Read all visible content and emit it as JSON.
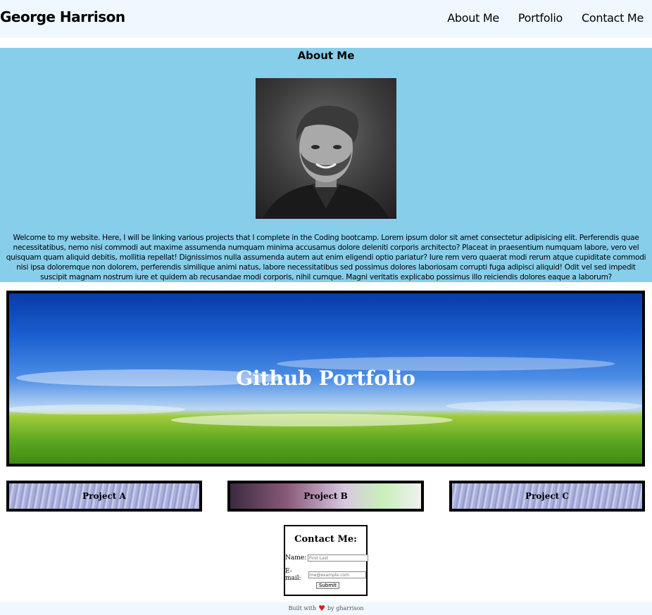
{
  "header": {
    "site_title": "George Harrison",
    "nav": [
      "About Me",
      "Portfolio",
      "Contact Me"
    ]
  },
  "about": {
    "heading": "About Me",
    "portrait_icon": "portrait-photo",
    "text": "Welcome to my website. Here, I will be linking various projects that I complete in the Coding bootcamp. Lorem ipsum dolor sit amet consectetur adipisicing elit. Perferendis quae necessitatibus, nemo nisi commodi aut maxime assumenda numquam minima accusamus dolore deleniti corporis architecto? Placeat in praesentium numquam labore, vero vel quisquam quam aliquid debitis, mollitia repellat! Dignissimos nulla assumenda autem aut enim eligendi optio pariatur? Iure rem vero quaerat modi rerum atque cupiditate commodi nisi ipsa doloremque non dolorem, perferendis similique animi natus, labore necessitatibus sed possimus dolores laboriosam corrupti fuga adipisci aliquid! Odit vel sed impedit suscipit magnam nostrum iure et quidem ab recusandae modi corporis, nihil cumque. Magni veritatis explicabo possimus illo reiciendis dolores eaque a laborum?"
  },
  "portfolio": {
    "banner_title": "Github Portfolio",
    "projects": [
      "Project A",
      "Project B",
      "Project C"
    ]
  },
  "contact": {
    "heading": "Contact Me:",
    "name_label": "Name:",
    "name_placeholder": "First Last",
    "email_label": "E-mail:",
    "email_placeholder": "me@example.com",
    "submit_label": "Submit"
  },
  "footer": {
    "built_with": "Built with",
    "by": "by gharrison",
    "heart_icon": "heart-icon"
  },
  "colors": {
    "header_bg": "#f0f8ff",
    "about_bg": "#87ceeb",
    "heart": "#d32020"
  }
}
